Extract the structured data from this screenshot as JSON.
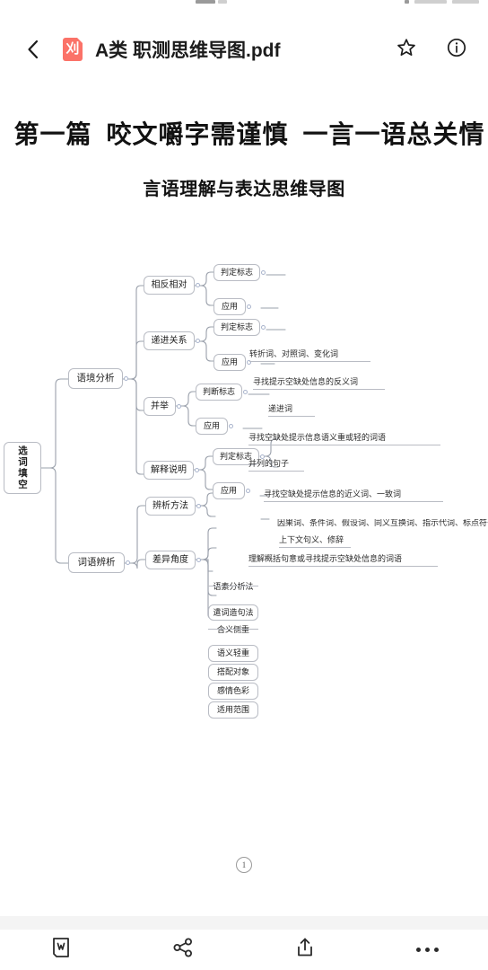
{
  "statusbar": {
    "visible": true
  },
  "header": {
    "back_icon": "chevron-left-icon",
    "file_icon": "pdf-file-icon",
    "file_icon_glyph": "刈",
    "title": "A类 职测思维导图.pdf",
    "star_icon": "star-outline-icon",
    "info_icon": "info-circle-icon",
    "accent_pdf_color": "#fb7268"
  },
  "document": {
    "title": "第一篇  咬文嚼字需谨慎  一言一语总关情",
    "subtitle": "言语理解与表达思维导图",
    "page_number": "1"
  },
  "mindmap": {
    "root": "选词填空",
    "branches": {
      "yujing": "语境分析",
      "ciyu": "词语辨析"
    },
    "nodes": {
      "xiangfan": "相反相对",
      "dijin": "递进关系",
      "bingju": "并举",
      "jieshi": "解释说明",
      "bianxi": "辨析方法",
      "chayi": "差异角度"
    },
    "labels": {
      "panding": "判定标志",
      "panduan": "判断标志",
      "yingyong": "应用"
    },
    "leaves": {
      "xiangfan_mark": "转折词、对照词、变化词",
      "xiangfan_use": "寻找提示空缺处信息的反义词",
      "dijin_mark": "递进词",
      "dijin_use": "寻找空缺处提示信息语义重或轻的词语",
      "bingju_mark": "并列的句子",
      "bingju_use": "寻找空缺处提示信息的近义词、一致词",
      "jieshi_mark1": "因果词、条件词、假设词、同义互换词、指示代词、标点符号",
      "jieshi_mark2": "上下文句义、修辞",
      "jieshi_use": "理解概括句意或寻找提示空缺处信息的词语",
      "bianxi_1": "语素分析法",
      "bianxi_2": "遣词造句法",
      "chayi_1": "含义侧重",
      "chayi_2": "语义轻重",
      "chayi_3": "搭配对象",
      "chayi_4": "感情色彩",
      "chayi_5": "适用范围"
    }
  },
  "toolbar": {
    "items": [
      {
        "icon": "wps-document-icon",
        "name": "document-button"
      },
      {
        "icon": "share-nodes-icon",
        "name": "share-button"
      },
      {
        "icon": "upload-export-icon",
        "name": "export-button"
      },
      {
        "icon": "more-horizontal-icon",
        "name": "more-button"
      }
    ]
  }
}
